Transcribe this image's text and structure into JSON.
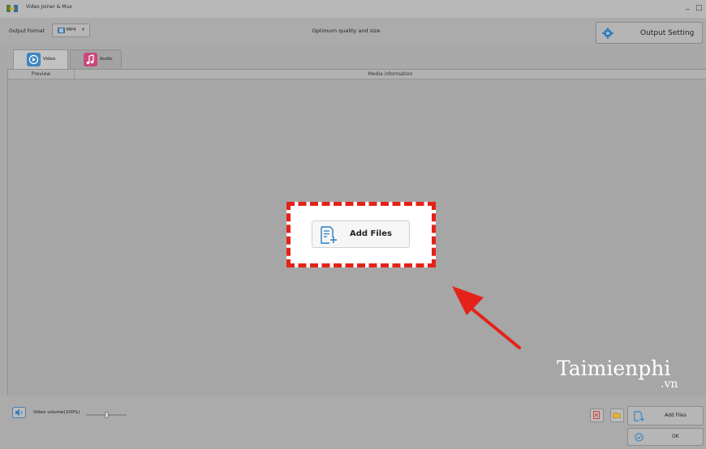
{
  "window": {
    "title": "Video Joiner & Mux",
    "minimize": "_",
    "maximize": "□"
  },
  "toolbar": {
    "output_format_label": "Output Format",
    "format_value": "MP4",
    "quality_text": "Optimum quality and size",
    "output_setting_label": "Output Setting"
  },
  "tabs": [
    {
      "label": "Video",
      "icon": "video-icon",
      "active": true
    },
    {
      "label": "Audio",
      "icon": "music-icon",
      "active": false
    }
  ],
  "table": {
    "columns": [
      "Preview",
      "Media information"
    ]
  },
  "center_button": {
    "label": "Add Files"
  },
  "watermark": {
    "name": "Taimienphi",
    "tld": ".vn"
  },
  "bottom": {
    "volume_label": "Video volume(100%)",
    "volume_value": 100,
    "add_files_label": "Add Files",
    "ok_label": "OK"
  },
  "colors": {
    "highlight": "#e5221a",
    "accent_blue": "#3d86c1",
    "audio_pink": "#c9487b"
  }
}
